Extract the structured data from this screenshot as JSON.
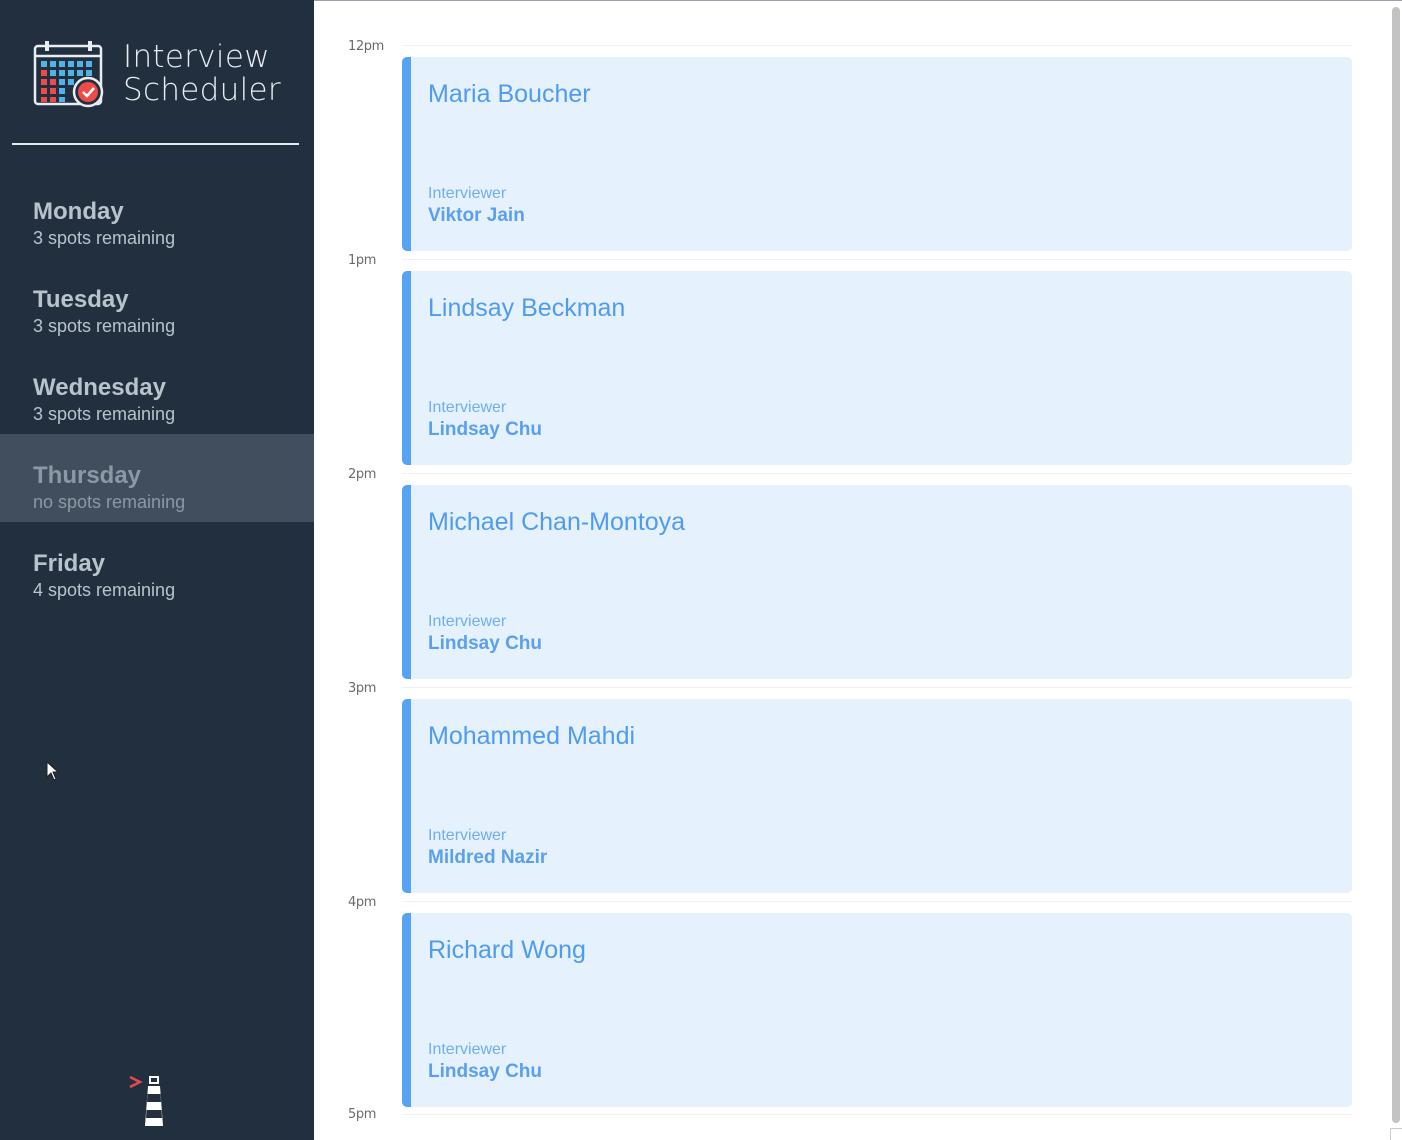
{
  "brand": {
    "line1": "Interview",
    "line2": "Scheduler"
  },
  "days": [
    {
      "name": "Monday",
      "spots": "3 spots remaining",
      "selected": false
    },
    {
      "name": "Tuesday",
      "spots": "3 spots remaining",
      "selected": false
    },
    {
      "name": "Wednesday",
      "spots": "3 spots remaining",
      "selected": false
    },
    {
      "name": "Thursday",
      "spots": "no spots remaining",
      "selected": true
    },
    {
      "name": "Friday",
      "spots": "4 spots remaining",
      "selected": false
    }
  ],
  "appointments": [
    {
      "time": "12pm",
      "student": "Maria Boucher",
      "interviewer_label": "Interviewer",
      "interviewer": "Viktor Jain"
    },
    {
      "time": "1pm",
      "student": "Lindsay Beckman",
      "interviewer_label": "Interviewer",
      "interviewer": "Lindsay Chu"
    },
    {
      "time": "2pm",
      "student": "Michael Chan-Montoya",
      "interviewer_label": "Interviewer",
      "interviewer": "Lindsay Chu"
    },
    {
      "time": "3pm",
      "student": "Mohammed Mahdi",
      "interviewer_label": "Interviewer",
      "interviewer": "Mildred Nazir"
    },
    {
      "time": "4pm",
      "student": "Richard Wong",
      "interviewer_label": "Interviewer",
      "interviewer": "Lindsay Chu"
    }
  ],
  "end_time": "5pm",
  "colors": {
    "sidebar": "#222f3e",
    "selected_day": "#414e5d",
    "card_bg": "#e5f1fd",
    "card_accent": "#56a3f5"
  }
}
